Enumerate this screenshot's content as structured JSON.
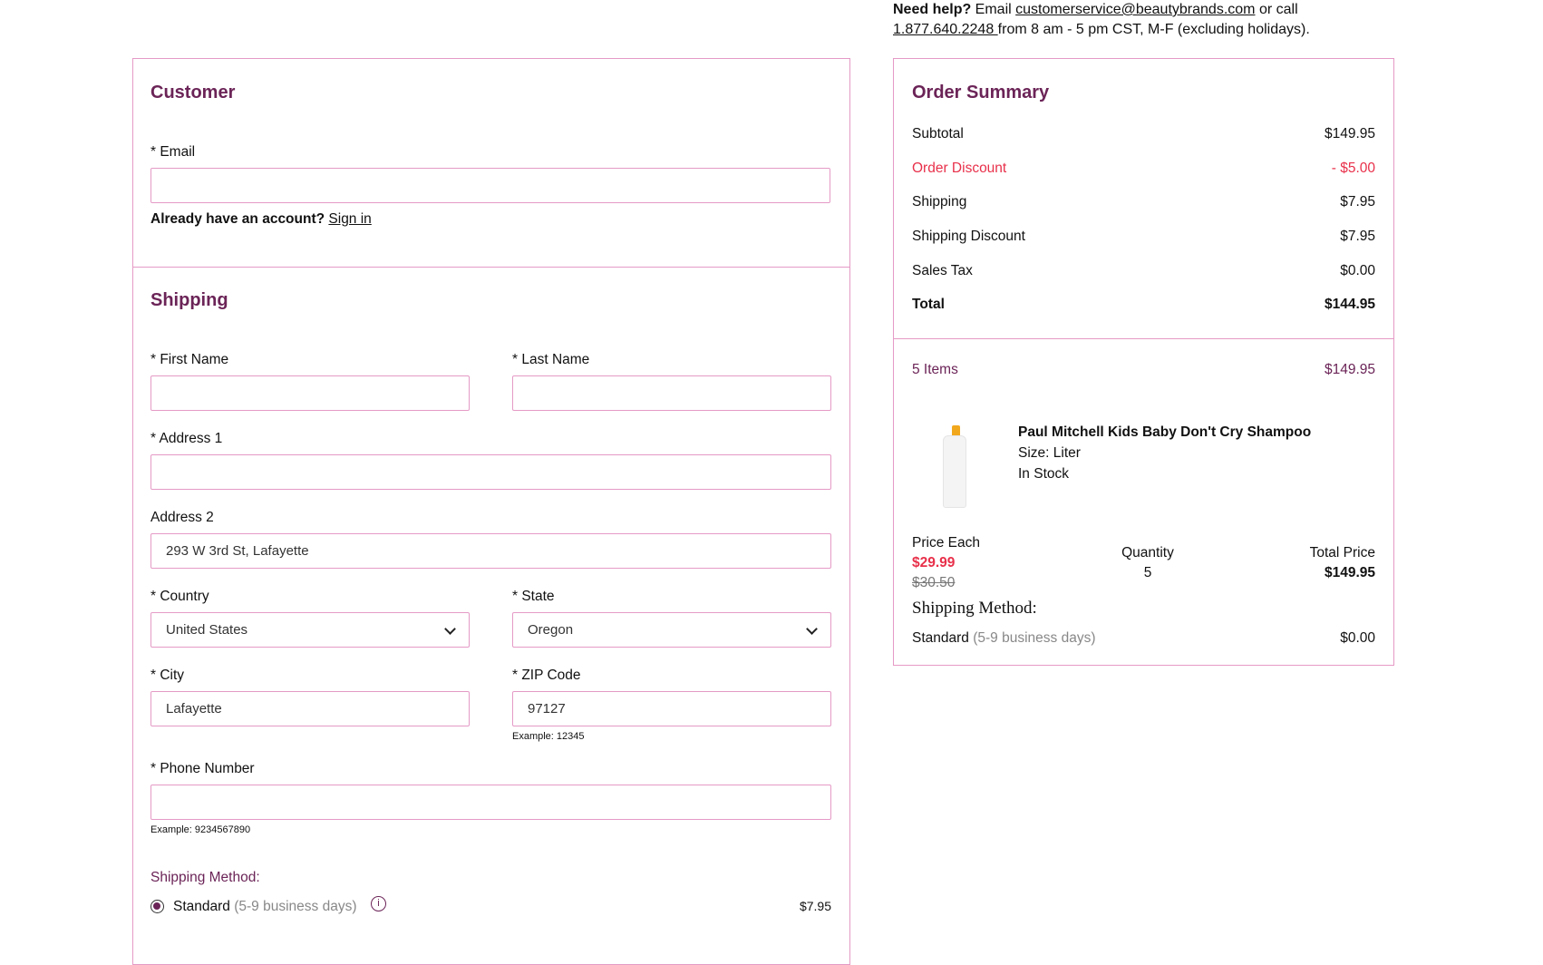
{
  "help": {
    "bold": "Need help?",
    "text1": " Email ",
    "email": "customerservice@beautybrands.com",
    "text2": " or call ",
    "phone": "1.877.640.2248 ",
    "text3": "from 8 am - 5 pm CST, M-F (excluding holidays)."
  },
  "customer": {
    "title": "Customer",
    "email_label": "* Email",
    "email_value": "",
    "account_text": "Already have an account?",
    "sign_in": "Sign in"
  },
  "shipping": {
    "title": "Shipping",
    "first_name_label": "* First Name",
    "last_name_label": "* Last Name",
    "address1_label": "* Address 1",
    "address2_label": "Address 2",
    "address2_value": "293 W 3rd St, Lafayette",
    "country_label": "* Country",
    "country_value": "United States",
    "state_label": "* State",
    "state_value": "Oregon",
    "city_label": "* City",
    "city_value": "Lafayette",
    "zip_label": "* ZIP Code",
    "zip_value": "97127",
    "zip_example": "Example: 12345",
    "phone_label": "* Phone Number",
    "phone_example": "Example: 9234567890",
    "method_label": "Shipping Method:",
    "method_name": "Standard",
    "method_days": "(5-9 business days)",
    "method_price": "$7.95"
  },
  "summary": {
    "title": "Order Summary",
    "rows": [
      {
        "label": "Subtotal",
        "value": "$149.95"
      },
      {
        "label": "Order Discount",
        "value": "- $5.00"
      },
      {
        "label": "Shipping",
        "value": "$7.95"
      },
      {
        "label": "Shipping Discount",
        "value": "$7.95"
      },
      {
        "label": "Sales Tax",
        "value": "$0.00"
      },
      {
        "label": "Total",
        "value": "$144.95"
      }
    ],
    "items_count": "5 Items",
    "items_total": "$149.95",
    "product": {
      "name": "Paul Mitchell Kids Baby Don't Cry Shampoo",
      "size": "Size: Liter",
      "stock": "In Stock",
      "price_each_label": "Price Each",
      "price": "$29.99",
      "orig_price": "$30.50",
      "qty_label": "Quantity",
      "qty": "5",
      "total_label": "Total Price",
      "total": "$149.95"
    },
    "method_label": "Shipping Method:",
    "method_name": "Standard",
    "method_days": "(5-9 business days)",
    "method_price": "$0.00"
  },
  "colors": {
    "accent": "#6b2457",
    "border": "#e59ac6",
    "discount": "#e8304a"
  }
}
